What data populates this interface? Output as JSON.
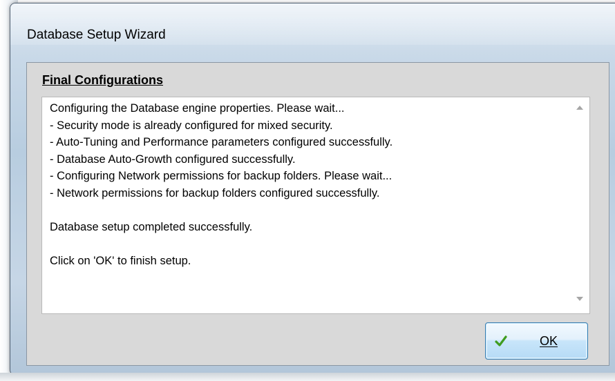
{
  "window": {
    "title": "Database Setup Wizard"
  },
  "section": {
    "label": "Final Configurations"
  },
  "log": {
    "lines": [
      "Configuring the Database engine properties.  Please wait...",
      "- Security mode is already configured for mixed security.",
      "- Auto-Tuning and Performance parameters configured successfully.",
      "- Database Auto-Growth configured successfully.",
      "- Configuring Network permissions for backup folders.  Please wait...",
      "- Network permissions for backup folders configured successfully.",
      "",
      "Database setup completed successfully.",
      "",
      "Click on 'OK' to finish setup."
    ]
  },
  "scrollbar": {
    "up_icon": "scroll-up-arrow",
    "down_icon": "scroll-down-arrow"
  },
  "buttons": {
    "ok_label": "OK",
    "ok_icon": "checkmark-icon"
  },
  "colors": {
    "check_green": "#3f9c1f",
    "button_border": "#3c7fb1"
  }
}
